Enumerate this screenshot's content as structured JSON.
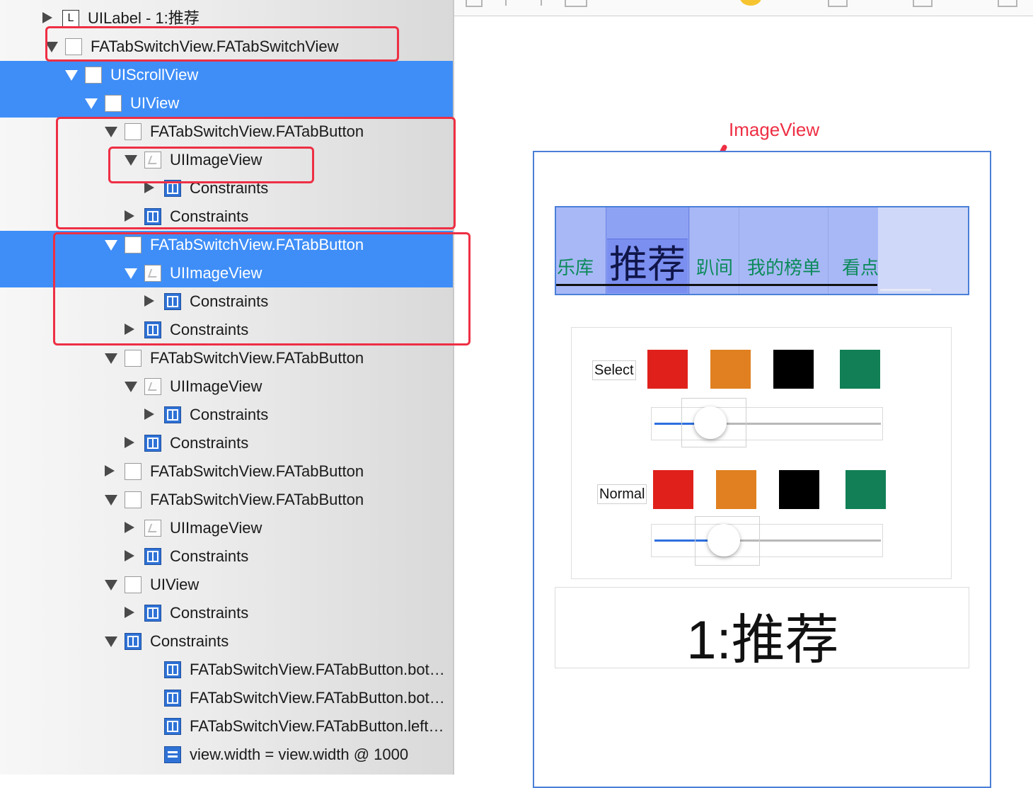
{
  "outline": {
    "rows": [
      {
        "disclosure": "closed",
        "icon": "label-icon",
        "icon_text": "L",
        "label": "UILabel - 1:推荐",
        "selected": false
      },
      {
        "disclosure": "open",
        "icon": "view-icon",
        "label": "FATabSwitchView.FATabSwitchView",
        "selected": false
      },
      {
        "disclosure": "open",
        "icon": "view-icon",
        "label": "UIScrollView",
        "selected": true
      },
      {
        "disclosure": "open",
        "icon": "view-icon",
        "label": "UIView",
        "selected": true
      },
      {
        "disclosure": "open",
        "icon": "view-icon",
        "label": "FATabSwitchView.FATabButton",
        "selected": false
      },
      {
        "disclosure": "open",
        "icon": "image-view-icon",
        "label": "UIImageView",
        "selected": false
      },
      {
        "disclosure": "closed",
        "icon": "constraints-icon",
        "label": "Constraints",
        "selected": false
      },
      {
        "disclosure": "closed",
        "icon": "constraints-icon",
        "label": "Constraints",
        "selected": false
      },
      {
        "disclosure": "open",
        "icon": "view-icon",
        "label": "FATabSwitchView.FATabButton",
        "selected": true
      },
      {
        "disclosure": "open",
        "icon": "image-view-icon",
        "label": "UIImageView",
        "selected": true
      },
      {
        "disclosure": "closed",
        "icon": "constraints-icon",
        "label": "Constraints",
        "selected": false
      },
      {
        "disclosure": "closed",
        "icon": "constraints-icon",
        "label": "Constraints",
        "selected": false
      },
      {
        "disclosure": "open",
        "icon": "view-icon",
        "label": "FATabSwitchView.FATabButton",
        "selected": false
      },
      {
        "disclosure": "open",
        "icon": "image-view-icon",
        "label": "UIImageView",
        "selected": false
      },
      {
        "disclosure": "closed",
        "icon": "constraints-icon",
        "label": "Constraints",
        "selected": false
      },
      {
        "disclosure": "closed",
        "icon": "constraints-icon",
        "label": "Constraints",
        "selected": false
      },
      {
        "disclosure": "closed",
        "icon": "view-icon",
        "label": "FATabSwitchView.FATabButton",
        "selected": false
      },
      {
        "disclosure": "open",
        "icon": "view-icon",
        "label": "FATabSwitchView.FATabButton",
        "selected": false
      },
      {
        "disclosure": "closed",
        "icon": "image-view-icon",
        "label": "UIImageView",
        "selected": false
      },
      {
        "disclosure": "closed",
        "icon": "constraints-icon",
        "label": "Constraints",
        "selected": false
      },
      {
        "disclosure": "open",
        "icon": "view-icon",
        "label": "UIView",
        "selected": false
      },
      {
        "disclosure": "closed",
        "icon": "constraints-icon",
        "label": "Constraints",
        "selected": false
      },
      {
        "disclosure": "open",
        "icon": "constraints-icon",
        "label": "Constraints",
        "selected": false
      },
      {
        "disclosure": "none",
        "icon": "constraints-icon",
        "label": "FATabSwitchView.FATabButton.bot…",
        "selected": false
      },
      {
        "disclosure": "none",
        "icon": "constraints-icon",
        "label": "FATabSwitchView.FATabButton.bot…",
        "selected": false
      },
      {
        "disclosure": "none",
        "icon": "constraints-icon",
        "label": "FATabSwitchView.FATabButton.left…",
        "selected": false
      },
      {
        "disclosure": "none",
        "icon": "equal-constraint-icon",
        "label": "view.width = view.width @ 1000",
        "selected": false
      }
    ]
  },
  "annotation": {
    "label": "ImageView",
    "color": "#ee2f44"
  },
  "tabs": {
    "items": [
      "乐库",
      "推荐",
      "趴间",
      "我的榜单",
      "看点"
    ],
    "active_index": 1
  },
  "color_panel": {
    "select_label": "Select",
    "normal_label": "Normal",
    "swatches": [
      {
        "name": "red",
        "color": "#e0211b"
      },
      {
        "name": "orange",
        "color": "#e08020"
      },
      {
        "name": "black",
        "color": "#000000"
      },
      {
        "name": "green",
        "color": "#127f56"
      }
    ],
    "select_slider_value": 0.25,
    "normal_slider_value": 0.31
  },
  "content_label": "1:推荐",
  "colors": {
    "selection": "#3f8ef7",
    "device_border": "#4b7fd8",
    "tab_text": "#0b8a5a"
  }
}
